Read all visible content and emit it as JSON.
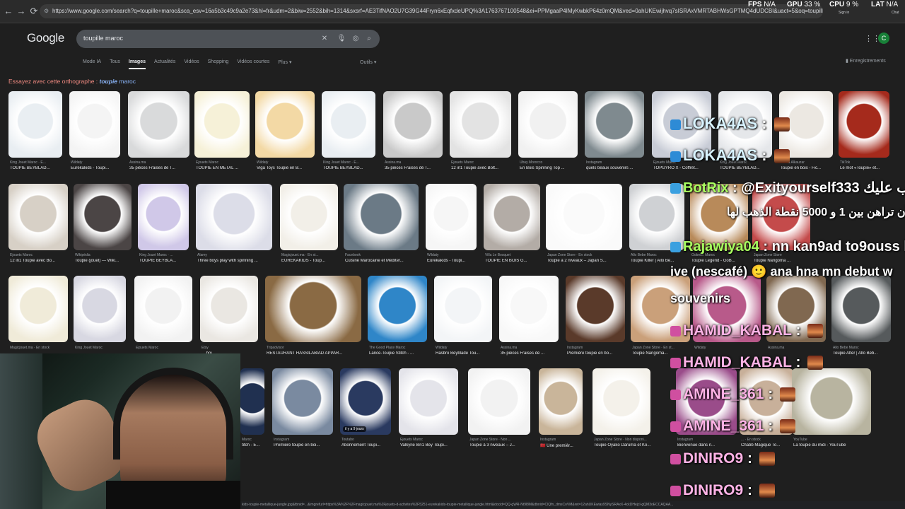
{
  "browser": {
    "url": "https://www.google.com/search?q=toupille+maroc&sca_esv=16a5b3c49c9a2e73&hl=fr&udm=2&biw=2552&bih=1314&sxsrf=AE3TifNAO2U7G39G44Fryn6xEqfxdeUPQ%3A1763767100548&ei=PPMgaaP4IMyKwbkP64z0mQM&ved=0ahUKEwijhvq7sISRAxVMRTABHWsGPTMQ4dUDCBI&uact=5&oq=toupille+maroc&gs_lp=Egtnd3Mtd26...",
    "stats": [
      {
        "label": "FPS",
        "value": "N/A"
      },
      {
        "label": "GPU",
        "value": "33 %"
      },
      {
        "label": "CPU",
        "value": "9 %"
      },
      {
        "label": "LAT",
        "value": "N/A"
      }
    ],
    "profile_chip": "Sign in",
    "chat_chip": "Chat"
  },
  "google": {
    "logo": "Google",
    "query": "toupille maroc",
    "tabs": [
      "Mode IA",
      "Tous",
      "Images",
      "Actualités",
      "Vidéos",
      "Shopping",
      "Vidéos courtes",
      "Plus ▾"
    ],
    "active_tab": "Images",
    "tools": "Outils ▾",
    "saved": "Enregistrements",
    "avatar_letter": "C",
    "spell_prefix": "Essayez avec cette orthographe : ",
    "spell_bold": "toupie",
    "spell_rest": " maroc"
  },
  "results": {
    "row1": [
      {
        "src": "King Jouet Maroc · E...",
        "title": "TOUPIE BEYBLAD..."
      },
      {
        "src": "Wildaty",
        "title": "Eurekakids - Toupi..."
      },
      {
        "src": "Assina.ma",
        "title": "35 pièces Fraises de T..."
      },
      {
        "src": "Ejouets Maroc",
        "title": "TOUPIE EN MÉTAL ..."
      },
      {
        "src": "Wildaty",
        "title": "Viga Toys Toupie en B..."
      },
      {
        "src": "King Jouet Maroc · E...",
        "title": "TOUPIE BEYBLAD..."
      },
      {
        "src": "Assina.ma",
        "title": "35 pièces Fraises de T..."
      },
      {
        "src": "Ejouets Maroc",
        "title": "12 in1 Toupie avec Bolt..."
      },
      {
        "src": "Ubuy Morocco",
        "title": "En Bois Spinning Top ..."
      },
      {
        "src": "Instagram",
        "title": "quels beaux souvenirs ..."
      },
      {
        "src": "Ejouets Maroc",
        "title": "TOPGYRO X - Coffret..."
      },
      {
        "src": "King Jouet Maroc",
        "title": "TOUPIE BEYBLAD..."
      },
      {
        "src": "Jumia Alkauzar",
        "title": "Toupie en bois - Fic..."
      },
      {
        "src": "TikTok",
        "title": "Le mot «Toupie» et..."
      }
    ],
    "row2": [
      {
        "src": "Ejouets Maroc",
        "title": "12 in1 Toupie avec Bo..."
      },
      {
        "src": "Wikipédia",
        "title": "Toupie (jouet) — Wiki..."
      },
      {
        "src": "King Jouet Maroc · ...",
        "title": "TOUPIE BEYBLA..."
      },
      {
        "src": "Alamy",
        "title": "Three boys play with spinning ..."
      },
      {
        "src": "Magicjouet.ma · En st...",
        "title": "EUREKAKIDS - Toup..."
      },
      {
        "src": "Facebook",
        "title": "Cuisine Marocaine et Méditer..."
      },
      {
        "src": "Wildaty",
        "title": "Eurekakids - Toupi..."
      },
      {
        "src": "Villa Le Bosquet",
        "title": "TOUPIE EN BOIS G..."
      },
      {
        "src": "Japan Zone Store · En stock",
        "title": "Toupie à 2 niveaux – Japan S..."
      },
      {
        "src": "Allo Bebe Maroc",
        "title": "Toupie Killer | Allo Be..."
      },
      {
        "src": "Gobebe Maroc",
        "title": "Toupie Legend - GoB..."
      },
      {
        "src": "Japan Zone Store",
        "title": "Toupie Narigoma ..."
      }
    ],
    "row3": [
      {
        "src": "Magicjouet.ma · En stock",
        "title": ""
      },
      {
        "src": "King Jouet Maroc",
        "title": ""
      },
      {
        "src": "Ejouets Maroc",
        "title": ""
      },
      {
        "src": "Etsy",
        "title": "... boi..."
      },
      {
        "src": "Tripadvisor",
        "title": "RESTAURANT HASSILABIAD APPAR..."
      },
      {
        "src": "The Good Place Maroc",
        "title": "Lance-Toupie Stitch - ..."
      },
      {
        "src": "Wildaty",
        "title": "Hasbro Beyblade Tou..."
      },
      {
        "src": "Assina.ma",
        "title": "35 pièces Fraises de ..."
      },
      {
        "src": "Instagram",
        "title": "Première toupie en bo..."
      },
      {
        "src": "Japan Zone Store · En st...",
        "title": "Toupie Narigoma..."
      },
      {
        "src": "Wildaty",
        "title": ""
      },
      {
        "src": "Assina.ma",
        "title": ""
      },
      {
        "src": "Allo Bebe Maroc",
        "title": "Toupie Alter | Allo Beb..."
      }
    ],
    "row4": [
      {
        "src": "Maroc",
        "title": "titch - É..."
      },
      {
        "src": "Instagram",
        "title": "Première toupie en boi..."
      },
      {
        "src": "Toutabo",
        "title": "Abonnement Toupi..."
      },
      {
        "src": "Ejouets Maroc",
        "title": "Valkyrie 8in1 Bey Toupi..."
      },
      {
        "src": "Japan Zone Store · Non ...",
        "title": "Toupie à 3 niveaux – J..."
      },
      {
        "src": "Instagram",
        "title": "🇲🇦 Une premièr..."
      },
      {
        "src": "Japan Zone Store · Non disponi...",
        "title": "Toupie Oyako Daruma et Ko..."
      },
      {
        "src": "Instagram",
        "title": "Bienvenue dans n..."
      },
      {
        "src": "... · En stock",
        "title": "Chabb Magique To..."
      },
      {
        "src": "YouTube",
        "title": "La toupie du midi - YouTube"
      }
    ],
    "badge_row4_3": "il y a 9 jours"
  },
  "chat": [
    {
      "user": "LOKA4AS",
      "text": ""
    },
    {
      "user": "LOKA4AS",
      "text": ""
    },
    {
      "user": "BotRix",
      "text": "@Exityourself333 يجب عليك"
    },
    {
      "user": "",
      "text": "أن تراهن بين 1 و 5000 نقطة الذهب لها"
    },
    {
      "user": "Rajawiya04",
      "text": "nn kan9ad to9ouss lo"
    },
    {
      "user": "",
      "text": "ive (nescafé) 🙂 ana hna mn debut w"
    },
    {
      "user": "",
      "text": "souvenirs"
    },
    {
      "user": "HAMID_KABAL",
      "text": ""
    },
    {
      "user": "HAMID_KABAL",
      "text": ""
    },
    {
      "user": "AMINE_361",
      "text": ""
    },
    {
      "user": "AMINE_361",
      "text": ""
    },
    {
      "user": "DINIRO9",
      "text": ""
    },
    {
      "user": "DINIRO9",
      "text": ""
    }
  ],
  "statusbar": "kids-toupie-metallique-jungle.jpg&tbnid=...&imgrefurl=https%3A%2F%2Fmagicjouet.ma%2Fjouets-d-activites%2F5251-eurekakids-toupie-metallique-jungle.html&docid=QQ-gWR-Nt9l8M&dbnid=ClQfn_dmsCoVM&ret=12ahUKEwias9SNySRAxX-4ckDHejcI-gQM3oECCAQAA..."
}
